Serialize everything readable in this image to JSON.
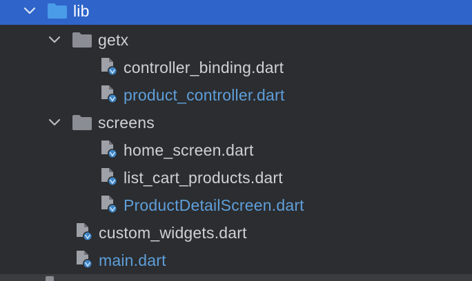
{
  "tree": {
    "root": {
      "label": "lib",
      "icon": "folder-icon",
      "expanded": true,
      "selected": true
    },
    "items": [
      {
        "label": "getx",
        "icon": "folder-icon",
        "type": "folder",
        "expanded": true,
        "status": "plain"
      },
      {
        "label": "controller_binding.dart",
        "icon": "dart-file-icon",
        "type": "file",
        "status": "plain"
      },
      {
        "label": "product_controller.dart",
        "icon": "dart-file-icon",
        "type": "file",
        "status": "modified"
      },
      {
        "label": "screens",
        "icon": "folder-icon",
        "type": "folder",
        "expanded": true,
        "status": "plain"
      },
      {
        "label": "home_screen.dart",
        "icon": "dart-file-icon",
        "type": "file",
        "status": "plain"
      },
      {
        "label": "list_cart_products.dart",
        "icon": "dart-file-icon",
        "type": "file",
        "status": "plain"
      },
      {
        "label": "ProductDetailScreen.dart",
        "icon": "dart-file-icon",
        "type": "file",
        "status": "modified"
      },
      {
        "label": "custom_widgets.dart",
        "icon": "dart-file-icon",
        "type": "file",
        "status": "plain"
      },
      {
        "label": "main.dart",
        "icon": "dart-file-icon",
        "type": "file",
        "status": "modified"
      }
    ]
  },
  "colors": {
    "background": "#2b2d30",
    "selection": "#2f65ca",
    "text_plain": "#cfd1d6",
    "text_modified": "#5f9fda",
    "folder_icon": "#8a8d93",
    "folder_icon_selected": "#4a9be8",
    "dart_badge": "#3f85c4"
  }
}
